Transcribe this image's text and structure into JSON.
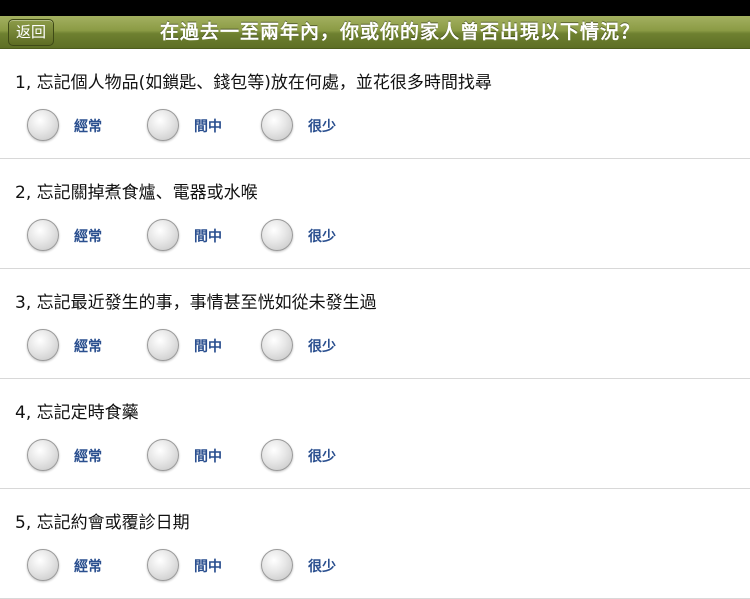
{
  "nav": {
    "back_label": "返回",
    "title": "在過去一至兩年內，你或你的家人曾否出現以下情況？"
  },
  "options": [
    "經常",
    "間中",
    "很少"
  ],
  "questions": [
    {
      "text": "1, 忘記個人物品(如鎖匙、錢包等)放在何處，並花很多時間找尋"
    },
    {
      "text": "2, 忘記關掉煮食爐、電器或水喉"
    },
    {
      "text": "3, 忘記最近發生的事，事情甚至恍如從未發生過"
    },
    {
      "text": "4, 忘記定時食藥"
    },
    {
      "text": "5, 忘記約會或覆診日期"
    }
  ]
}
